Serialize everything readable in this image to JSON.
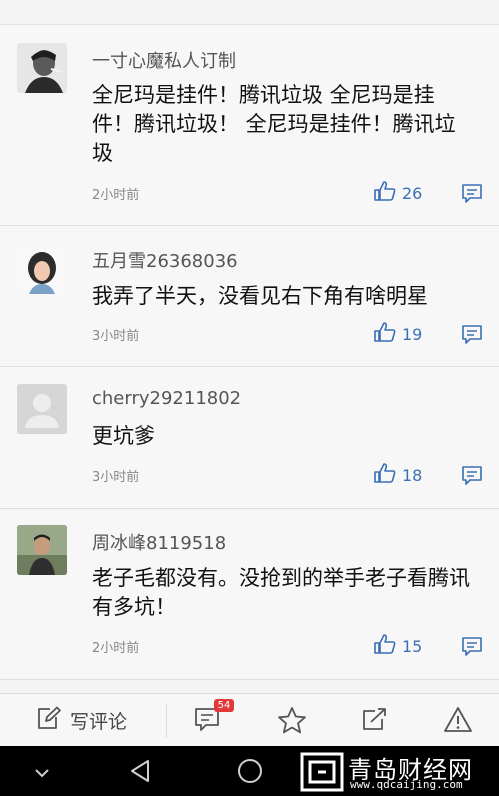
{
  "comments": [
    {
      "username": "一寸心魔私人订制",
      "content": "全尼玛是挂件！腾讯垃圾 全尼玛是挂件！腾讯垃圾！ 全尼玛是挂件！腾讯垃圾",
      "time": "2小时前",
      "likes": "26",
      "avatar": "avatar-man-smoking"
    },
    {
      "username": "五月雪26368036",
      "content": "我弄了半天，没看见右下角有啥明星",
      "time": "3小时前",
      "likes": "19",
      "avatar": "avatar-woman-portrait"
    },
    {
      "username": "cherry29211802",
      "content": "更坑爹",
      "time": "3小时前",
      "likes": "18",
      "avatar": "avatar-default"
    },
    {
      "username": "周冰峰8119518",
      "content": "老子毛都没有。没抢到的举手老子看腾讯有多坑！",
      "time": "2小时前",
      "likes": "15",
      "avatar": "avatar-man-outdoor"
    }
  ],
  "bottom_bar": {
    "write_label": "写评论",
    "comments_badge": "54",
    "icons": [
      "edit-icon",
      "comments-icon",
      "star-icon",
      "share-icon",
      "warning-icon"
    ]
  },
  "nav_bar": {
    "icons": [
      "chevron-down-icon",
      "back-icon",
      "home-icon"
    ]
  },
  "watermark": {
    "title": "青岛财经网",
    "url": "www.qdcaijing.com"
  },
  "colors": {
    "accent": "#3b6fb6",
    "badge": "#e23a3a",
    "background": "#f7f7f7"
  }
}
